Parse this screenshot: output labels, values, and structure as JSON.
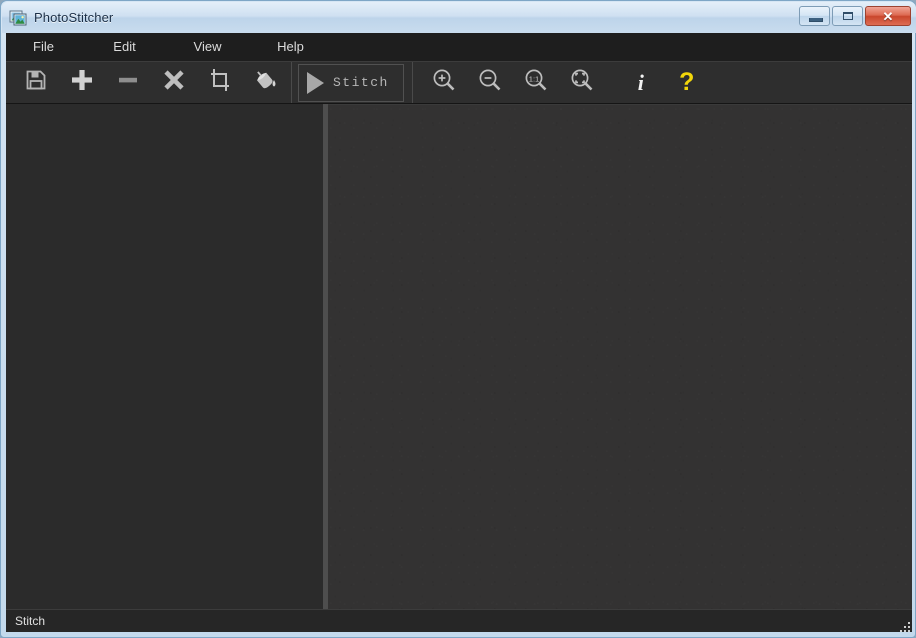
{
  "window": {
    "title": "PhotoStitcher",
    "app_icon": "photo-stack-icon",
    "controls": {
      "minimize_label": "",
      "maximize_label": "",
      "close_label": "✕"
    }
  },
  "menu": {
    "items": [
      {
        "label": "File",
        "name": "menu-file"
      },
      {
        "label": "Edit",
        "name": "menu-edit"
      },
      {
        "label": "View",
        "name": "menu-view"
      },
      {
        "label": "Help",
        "name": "menu-help"
      }
    ]
  },
  "toolbar": {
    "buttons": [
      {
        "label": "Save",
        "icon": "save-floppy-icon"
      },
      {
        "label": "Add",
        "icon": "plus-icon"
      },
      {
        "label": "Remove",
        "icon": "minus-icon"
      },
      {
        "label": "Delete",
        "icon": "close-x-icon"
      },
      {
        "label": "Crop",
        "icon": "crop-icon"
      },
      {
        "label": "Fill",
        "icon": "paint-bucket-icon"
      },
      {
        "label": "Zoom In",
        "icon": "zoom-in-icon"
      },
      {
        "label": "Zoom Out",
        "icon": "zoom-out-icon"
      },
      {
        "label": "Actual Size",
        "icon": "zoom-actual-size-icon"
      },
      {
        "label": "Fit To Window",
        "icon": "zoom-fit-icon"
      },
      {
        "label": "About",
        "icon": "info-icon"
      },
      {
        "label": "Help",
        "icon": "question-mark-icon"
      }
    ],
    "stitch": {
      "label": "Stitch",
      "icon": "play-triangle-icon"
    },
    "zoom_actual_label": "1:1"
  },
  "status": {
    "text": "Stitch"
  },
  "colors": {
    "help_accent": "#f2d60a",
    "toolbar_bg": "#2e2e2e",
    "panel_bg": "#2b2b2b",
    "canvas_bg": "#333232",
    "close_button": "#c9462c"
  }
}
